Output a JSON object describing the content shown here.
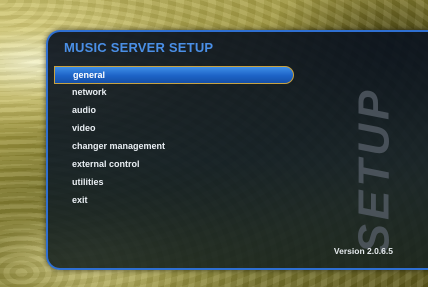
{
  "panel": {
    "title": "MUSIC SERVER SETUP",
    "watermark": "SETUP",
    "version": "Version 2.0.6.5"
  },
  "menu": {
    "selected_index": 0,
    "items": [
      {
        "label": "general"
      },
      {
        "label": "network"
      },
      {
        "label": "audio"
      },
      {
        "label": "video"
      },
      {
        "label": "changer management"
      },
      {
        "label": "external control"
      },
      {
        "label": "utilities"
      },
      {
        "label": "exit"
      }
    ]
  },
  "colors": {
    "accent": "#2f6fd0",
    "title": "#4a8fe6",
    "selection_fill": "#1d63c6",
    "selection_border": "#c8a242"
  }
}
